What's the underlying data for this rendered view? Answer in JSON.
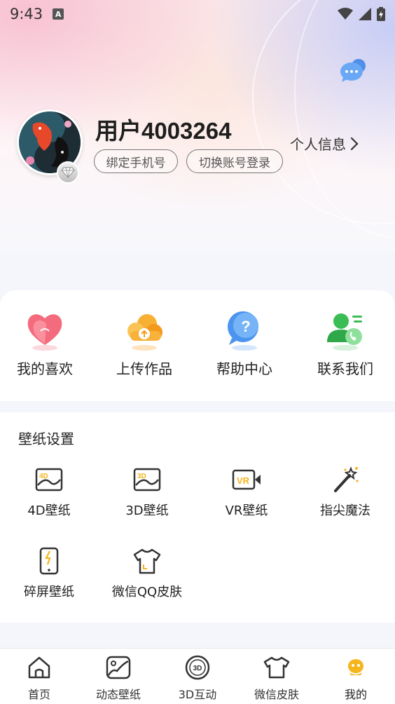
{
  "status_bar": {
    "time": "9:43",
    "notification_icon": "a-icon"
  },
  "header": {
    "message_icon": "chat-bubble-icon"
  },
  "profile": {
    "username": "用户4003264",
    "bind_phone_label": "绑定手机号",
    "switch_account_label": "切换账号登录",
    "profile_info_label": "个人信息"
  },
  "quick_actions": [
    {
      "label": "我的喜欢",
      "icon": "heart-icon"
    },
    {
      "label": "上传作品",
      "icon": "upload-cloud-icon"
    },
    {
      "label": "帮助中心",
      "icon": "help-bubble-icon"
    },
    {
      "label": "联系我们",
      "icon": "contact-phone-icon"
    }
  ],
  "wallpaper_settings": {
    "title": "壁纸设置",
    "items": [
      {
        "label": "4D壁纸",
        "icon": "4d-wallpaper-icon",
        "badge": "4D"
      },
      {
        "label": "3D壁纸",
        "icon": "3d-wallpaper-icon",
        "badge": "3D"
      },
      {
        "label": "VR壁纸",
        "icon": "vr-camera-icon",
        "badge": "VR"
      },
      {
        "label": "指尖魔法",
        "icon": "magic-wand-icon"
      },
      {
        "label": "碎屏壁纸",
        "icon": "broken-screen-icon"
      },
      {
        "label": "微信QQ皮肤",
        "icon": "tshirt-icon"
      }
    ]
  },
  "bottom_nav": [
    {
      "label": "首页",
      "icon": "home-icon"
    },
    {
      "label": "动态壁纸",
      "icon": "dynamic-wallpaper-icon"
    },
    {
      "label": "3D互动",
      "icon": "3d-interact-icon",
      "badge": "3D"
    },
    {
      "label": "微信皮肤",
      "icon": "tshirt-icon"
    },
    {
      "label": "我的",
      "icon": "mine-avatar-icon"
    }
  ],
  "colors": {
    "accent_yellow": "#f5b51e",
    "chip_border": "#777777",
    "icon_dark": "#333333"
  }
}
